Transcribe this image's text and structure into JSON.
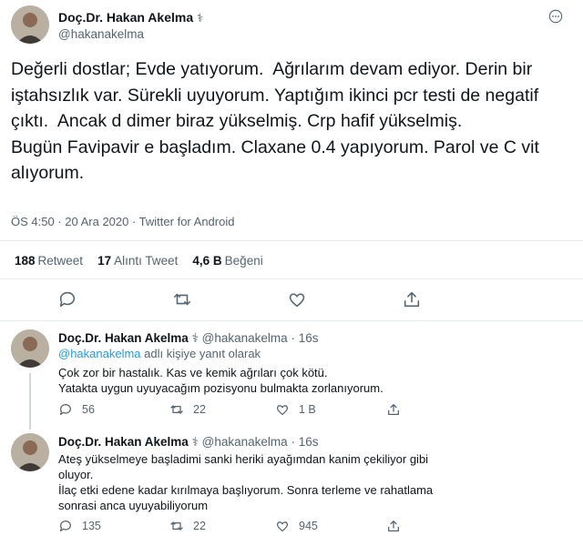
{
  "main_tweet": {
    "author_name": "Doç.Dr. Hakan Akelma",
    "author_emoji": "⚕",
    "handle": "@hakanakelma",
    "text": "Değerli dostlar; Evde yatıyorum.  Ağrılarım devam ediyor. Derin bir iştahsızlık var. Sürekli uyuyorum. Yaptığım ikinci pcr testi de negatif çıktı.  Ancak d dimer biraz yükselmiş. Crp hafif yükselmiş.\nBugün Favipavir e başladım. Claxane 0.4 yapıyorum. Parol ve C vit  alıyorum.",
    "timestamp": "ÖS 4:50 · 20 Ara 2020 · Twitter for Android",
    "stats": {
      "retweets_count": "188",
      "retweets_label": "Retweet",
      "quotes_count": "17",
      "quotes_label": "Alıntı Tweet",
      "likes_count": "4,6 B",
      "likes_label": "Beğeni"
    }
  },
  "replies": [
    {
      "author_name": "Doç.Dr. Hakan Akelma",
      "author_emoji": "⚕",
      "handle": "@hakanakelma",
      "time": "16s",
      "replying_to_handle": "@hakanakelma",
      "replying_to_suffix": "adlı kişiye yanıt olarak",
      "text": "Çok zor bir hastalık. Kas ve kemik ağrıları çok kötü.\nYatakta uygun uyuyacağım pozisyonu bulmakta zorlanıyorum.",
      "reply_count": "56",
      "retweet_count": "22",
      "like_count": "1 B"
    },
    {
      "author_name": "Doç.Dr. Hakan Akelma",
      "author_emoji": "⚕",
      "handle": "@hakanakelma",
      "time": "16s",
      "text": "Ateş yükselmeye başladimi sanki heriki ayağımdan kanim çekiliyor gibi oluyor.\nİlaç etki edene kadar kırılmaya başlıyorum. Sonra terleme ve rahatlama sonrasi anca uyuyabiliyorum",
      "reply_count": "135",
      "retweet_count": "22",
      "like_count": "945"
    }
  ]
}
